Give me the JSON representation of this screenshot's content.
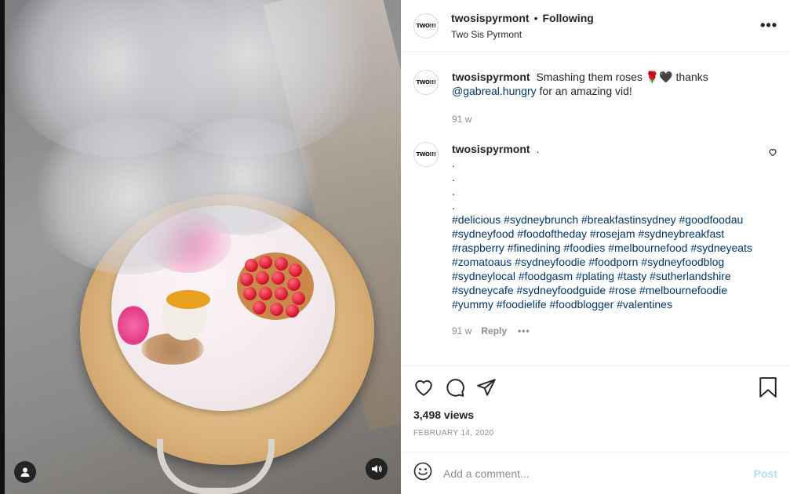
{
  "post": {
    "author": {
      "username": "twosispyrmont",
      "follow_status": "Following",
      "location": "Two Sis Pyrmont",
      "avatar_text": "TWO!!!"
    },
    "more_icon": "ellipsis-icon"
  },
  "comments": [
    {
      "username": "twosispyrmont",
      "text_before": "Smashing them roses 🌹🖤 thanks",
      "mention": "@gabreal.hungry",
      "text_after": "for an amazing vid!",
      "time": "91 w"
    },
    {
      "username": "twosispyrmont",
      "first_line": ".",
      "dots": [
        ".",
        ".",
        ".",
        "."
      ],
      "hashtags": "#delicious #sydneybrunch #breakfastinsydney #goodfoodau #sydneyfood #foodoftheday #rosejam #sydneybreakfast #raspberry #finedining #foodies #melbournefood #sydneyeats #zomatoaus #sydneyfoodie #foodporn #sydneyfoodblog #sydneylocal #foodgasm #plating #tasty #sutherlandshire #sydneycafe #sydneyfoodguide #rose #melbournefoodie #yummy #foodielife #foodblogger #valentines",
      "time": "91 w",
      "reply_label": "Reply",
      "more_dots": "•••"
    }
  ],
  "actions": {
    "icons": [
      "heart-icon",
      "comment-icon",
      "share-icon",
      "bookmark-icon"
    ],
    "views": "3,498 views",
    "date": "FEBRUARY 14, 2020"
  },
  "composer": {
    "placeholder": "Add a comment...",
    "post_label": "Post"
  },
  "colors": {
    "link": "#00376b",
    "muted": "#8e8e8e",
    "post_disabled": "#b2dffc",
    "border": "#efefef"
  }
}
